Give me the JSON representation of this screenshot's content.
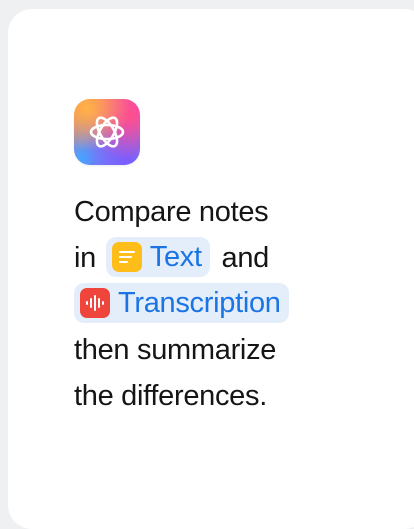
{
  "colors": {
    "card_background": "#ffffff",
    "page_background": "#eef0f2",
    "chip_background": "#e4eefb",
    "chip_text": "#1b74e4",
    "text_icon_color": "#ffbd1a",
    "transcription_icon_color": "#f0453a"
  },
  "app": {
    "icon": "apple-intelligence-icon"
  },
  "message": {
    "line1": "Compare notes",
    "line2_prefix": "in",
    "chip_text": {
      "label": "Text",
      "icon": "notes-icon"
    },
    "line2_suffix": "and",
    "chip_transcription": {
      "label": "Transcription",
      "icon": "waveform-icon"
    },
    "line4": "then summarize",
    "line5": "the differences."
  }
}
